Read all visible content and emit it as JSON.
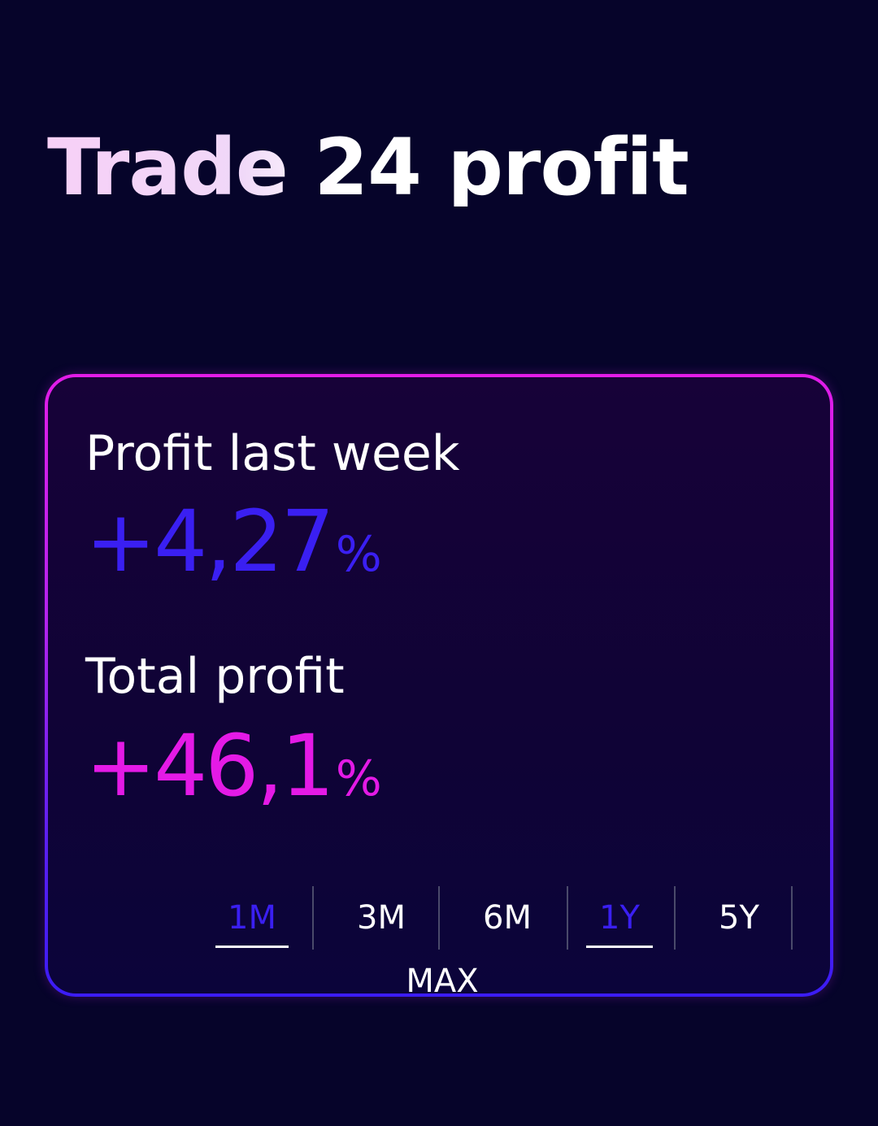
{
  "header": {
    "title": "Trade 24 profit"
  },
  "profit_card": {
    "last_week": {
      "label": "Profit last week",
      "value": "+4,27",
      "unit": "%"
    },
    "total": {
      "label": "Total profit",
      "value": "+46,1",
      "unit": "%"
    },
    "range_selector": {
      "options": [
        "1M",
        "3M",
        "6M",
        "1Y",
        "5Y",
        "MAX"
      ],
      "active": [
        "1M",
        "1Y"
      ]
    }
  },
  "colors": {
    "background": "#06042a",
    "accent_blue": "#3a1ff2",
    "accent_magenta": "#e41ae6",
    "card_border_top": "#e21ce8",
    "card_border_bottom": "#3b1cf5"
  }
}
